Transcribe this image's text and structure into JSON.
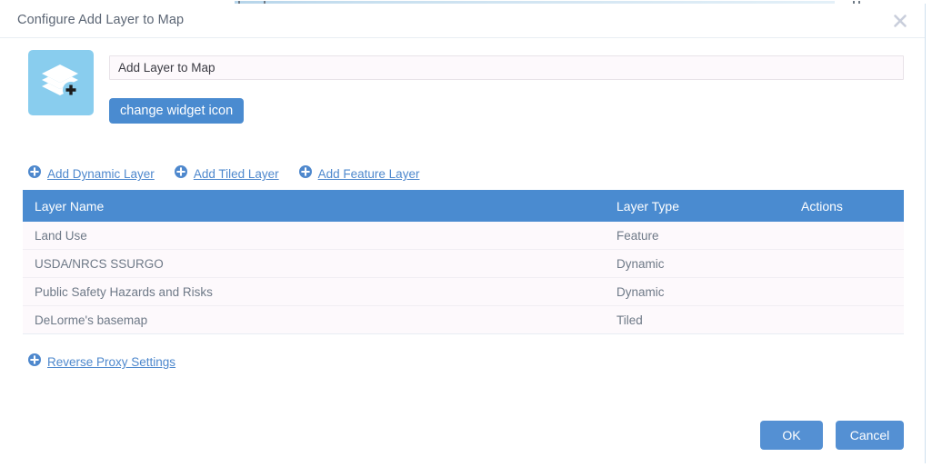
{
  "dialog": {
    "title": "Configure Add Layer to Map",
    "close_icon": "close-icon"
  },
  "widget": {
    "icon_name": "layers-plus-icon",
    "name_value": "Add Layer to Map",
    "name_placeholder": "Add Layer to Map",
    "change_icon_label": "change widget icon"
  },
  "add_links": [
    {
      "label": "Add Dynamic Layer",
      "icon": "plus-circle-icon"
    },
    {
      "label": "Add Tiled Layer",
      "icon": "plus-circle-icon"
    },
    {
      "label": "Add Feature Layer",
      "icon": "plus-circle-icon"
    }
  ],
  "table": {
    "columns": [
      "Layer Name",
      "Layer Type",
      "Actions"
    ],
    "rows": [
      {
        "name": "Land Use",
        "type": "Feature",
        "actions": ""
      },
      {
        "name": "USDA/NRCS SSURGO",
        "type": "Dynamic",
        "actions": ""
      },
      {
        "name": "Public Safety Hazards and Risks",
        "type": "Dynamic",
        "actions": ""
      },
      {
        "name": "DeLorme's basemap",
        "type": "Tiled",
        "actions": ""
      }
    ]
  },
  "proxy": {
    "label": "Reverse Proxy Settings",
    "icon": "plus-circle-icon"
  },
  "footer": {
    "ok_label": "OK",
    "cancel_label": "Cancel"
  },
  "colors": {
    "header_blue": "#4a8bd0",
    "button_blue": "#5490d3",
    "icon_tile_blue": "#89cdee",
    "link_blue": "#4e88cd",
    "row_bg": "#fdf9fc",
    "title_text": "#5b6574",
    "cell_text": "#6e7987"
  }
}
